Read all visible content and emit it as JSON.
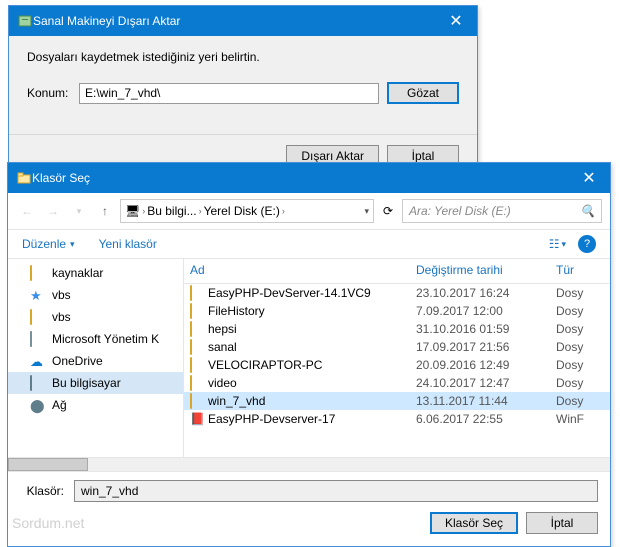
{
  "export": {
    "title": "Sanal Makineyi Dışarı Aktar",
    "message": "Dosyaları kaydetmek istediğiniz yeri belirtin.",
    "location_label": "Konum:",
    "location_value": "E:\\win_7_vhd\\",
    "browse": "Gözat",
    "export_btn": "Dışarı Aktar",
    "cancel": "İptal"
  },
  "folder": {
    "title": "Klasör Seç",
    "crumbs": {
      "pc": "Bu bilgi...",
      "drive": "Yerel Disk (E:)"
    },
    "search_placeholder": "Ara: Yerel Disk (E:)",
    "tools": {
      "organize": "Düzenle",
      "newfolder": "Yeni klasör"
    },
    "tree": [
      {
        "icon": "folder",
        "label": "kaynaklar"
      },
      {
        "icon": "star",
        "label": "vbs"
      },
      {
        "icon": "folder",
        "label": "vbs"
      },
      {
        "icon": "disk",
        "label": "Microsoft Yönetim K"
      },
      {
        "icon": "cloud",
        "label": "OneDrive"
      },
      {
        "icon": "pc",
        "label": "Bu bilgisayar",
        "selected": true
      },
      {
        "icon": "net",
        "label": "Ağ"
      }
    ],
    "cols": {
      "name": "Ad",
      "date": "Değiştirme tarihi",
      "type": "Tür"
    },
    "rows": [
      {
        "icon": "folder",
        "name": "EasyPHP-DevServer-14.1VC9",
        "date": "23.10.2017 16:24",
        "type": "Dosy"
      },
      {
        "icon": "folder",
        "name": "FileHistory",
        "date": "7.09.2017 12:00",
        "type": "Dosy"
      },
      {
        "icon": "folder",
        "name": "hepsi",
        "date": "31.10.2016 01:59",
        "type": "Dosy"
      },
      {
        "icon": "folder",
        "name": "sanal",
        "date": "17.09.2017 21:56",
        "type": "Dosy"
      },
      {
        "icon": "folder",
        "name": "VELOCIRAPTOR-PC",
        "date": "20.09.2016 12:49",
        "type": "Dosy"
      },
      {
        "icon": "folder",
        "name": "video",
        "date": "24.10.2017 12:47",
        "type": "Dosy"
      },
      {
        "icon": "folder",
        "name": "win_7_vhd",
        "date": "13.11.2017 11:44",
        "type": "Dosy",
        "selected": true
      },
      {
        "icon": "archive",
        "name": "EasyPHP-Devserver-17",
        "date": "6.06.2017 22:55",
        "type": "WinF"
      }
    ],
    "folder_label": "Klasör:",
    "folder_value": "win_7_vhd",
    "select_btn": "Klasör Seç",
    "cancel_btn": "İptal"
  },
  "watermark": "Sordum.net"
}
